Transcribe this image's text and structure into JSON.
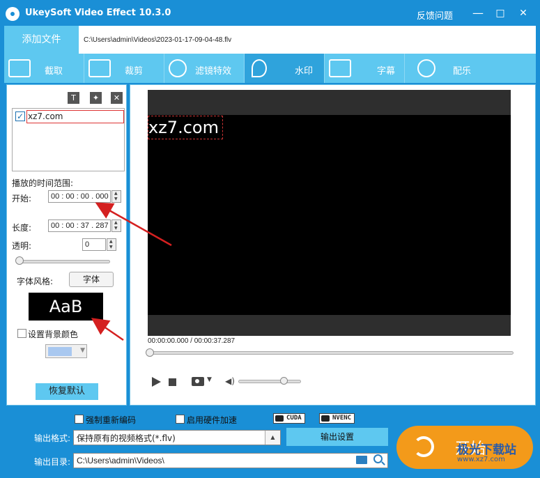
{
  "app": {
    "title": "UkeySoft Video Effect 10.3.0",
    "feedback": "反馈问题",
    "minimize": "—",
    "maximize": "□",
    "close": "✕"
  },
  "file": {
    "add_label": "添加文件",
    "path": "C:\\Users\\admin\\Videos\\2023-01-17-09-04-48.flv"
  },
  "tabs": [
    {
      "label": "截取",
      "icon": "trim-icon"
    },
    {
      "label": "裁剪",
      "icon": "crop-icon"
    },
    {
      "label": "滤镜特效",
      "icon": "filter-effects-icon"
    },
    {
      "label": "水印",
      "icon": "watermark-icon",
      "active": true
    },
    {
      "label": "字幕",
      "icon": "subtitle-icon"
    },
    {
      "label": "配乐",
      "icon": "music-icon"
    }
  ],
  "watermark": {
    "items": [
      {
        "text": "xz7.com",
        "checked": true
      }
    ],
    "time_range_label": "播放的时间范围:",
    "start_label": "开始:",
    "start_value": "00 : 00 : 00 . 000",
    "length_label": "长度:",
    "length_value": "00 : 00 : 37 . 287",
    "opacity_label": "透明:",
    "opacity_value": "0",
    "font_style_label": "字体风格:",
    "font_button": "字体",
    "font_preview": "AaB",
    "bg_color_label": "设置背景颜色",
    "restore_default": "恢复默认"
  },
  "player": {
    "overlay_text": "xz7.com",
    "time": "00:00:00.000 / 00:00:37.287"
  },
  "bottom": {
    "force_reencode": "强制重新编码",
    "hw_accel": "启用硬件加速",
    "badge_cuda": "CUDA",
    "badge_nvenc": "NVENC",
    "output_format_label": "输出格式:",
    "output_format_value": "保持原有的视频格式(*.flv)",
    "output_settings": "输出设置",
    "output_dir_label": "输出目录:",
    "output_dir_value": "C:\\Users\\admin\\Videos\\",
    "start": "开始"
  },
  "site_watermark": {
    "line1": "极光下载站",
    "line2": "www.xz7.com"
  },
  "colors": {
    "titlebar": "#1a8fd6",
    "tab_bg": "#5ec8f0",
    "start_button": "#f39a1a",
    "annotation_arrow": "#d42020"
  }
}
